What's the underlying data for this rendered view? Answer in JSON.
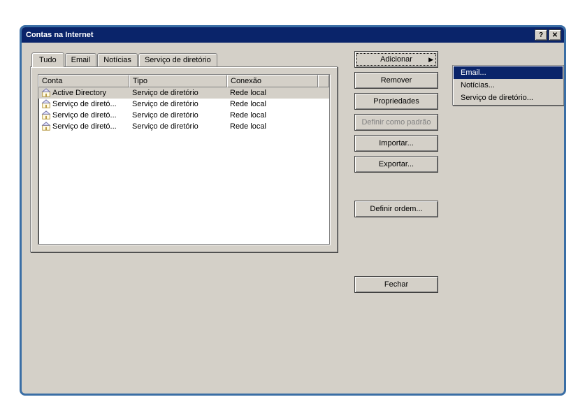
{
  "window": {
    "title": "Contas na Internet",
    "help_glyph": "?",
    "close_glyph": "✕"
  },
  "tabs": [
    {
      "label": "Tudo",
      "active": true
    },
    {
      "label": "Email",
      "active": false
    },
    {
      "label": "Notícias",
      "active": false
    },
    {
      "label": "Serviço de diretório",
      "active": false
    }
  ],
  "list": {
    "columns": {
      "account": "Conta",
      "type": "Tipo",
      "connection": "Conexão"
    },
    "rows": [
      {
        "account": "Active Directory",
        "type": "Serviço de diretório",
        "connection": "Rede local",
        "selected": true
      },
      {
        "account": "Serviço de diretó...",
        "type": "Serviço de diretório",
        "connection": "Rede local",
        "selected": false
      },
      {
        "account": "Serviço de diretó...",
        "type": "Serviço de diretório",
        "connection": "Rede local",
        "selected": false
      },
      {
        "account": "Serviço de diretó...",
        "type": "Serviço de diretório",
        "connection": "Rede local",
        "selected": false
      }
    ]
  },
  "buttons": {
    "add": "Adicionar",
    "remove": "Remover",
    "properties": "Propriedades",
    "set_default": "Definir como padrão",
    "import": "Importar...",
    "export": "Exportar...",
    "order": "Definir ordem...",
    "close": "Fechar"
  },
  "add_menu": {
    "email": "Email...",
    "news": "Notícias...",
    "directory": "Serviço de diretório..."
  }
}
